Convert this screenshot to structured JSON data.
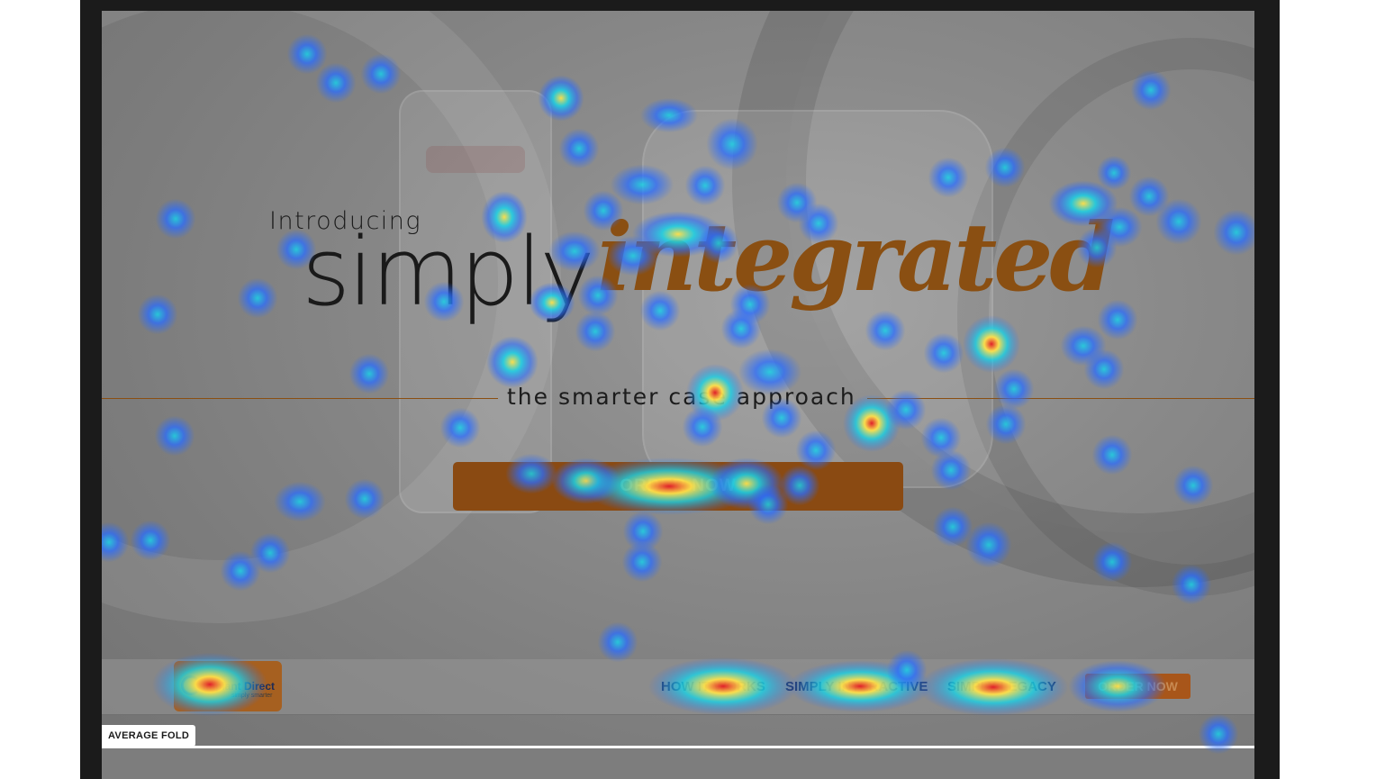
{
  "hero": {
    "intro": "Introducing",
    "brand_plain": "simply",
    "brand_script": "integrated",
    "tagline": "the smarter case approach",
    "cta_label": "ORDER NOW"
  },
  "nav": {
    "logo_name": "Implant Direct",
    "logo_tagline": "simply smarter",
    "items": [
      "HOW IT WORKS",
      "SIMPLY INTERACTIVE",
      "SIMPLY LEGACY"
    ],
    "order_label": "ORDER NOW"
  },
  "fold": {
    "label": "AVERAGE FOLD"
  },
  "heatmap": {
    "colors": {
      "cold": "#2a6cff",
      "cool": "#19d2e6",
      "warm": "#ffe14a",
      "hot": "#e0202a"
    }
  }
}
